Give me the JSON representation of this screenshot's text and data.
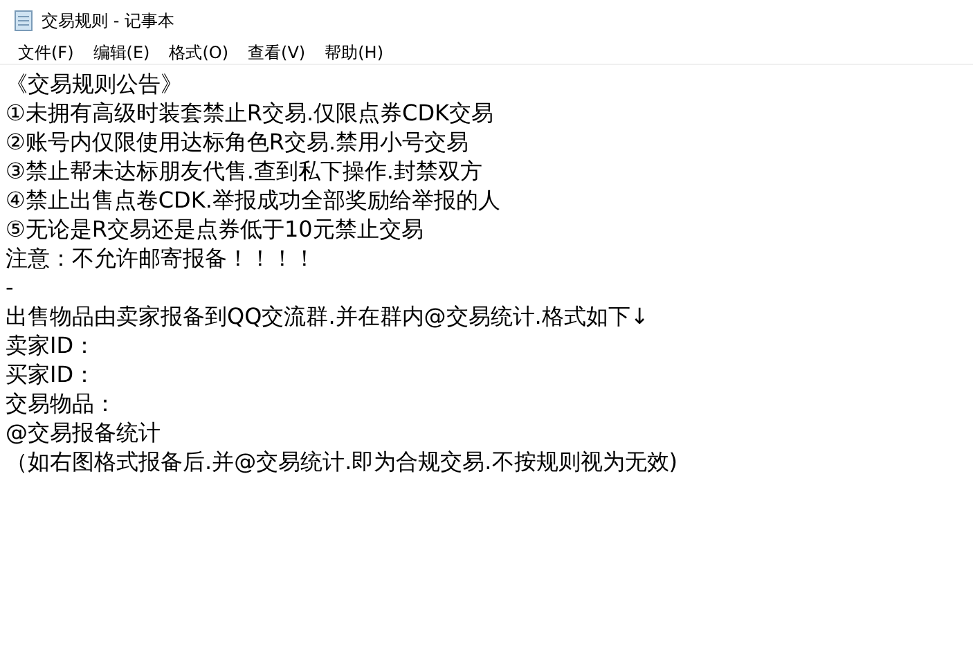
{
  "window": {
    "title": "交易规则 - 记事本"
  },
  "menu": [
    "文件(F)",
    "编辑(E)",
    "格式(O)",
    "查看(V)",
    "帮助(H)"
  ],
  "document": {
    "lines": [
      "《交易规则公告》",
      "①未拥有高级时装套禁止R交易.仅限点券CDK交易",
      "②账号内仅限使用达标角色R交易.禁用小号交易",
      "③禁止帮未达标朋友代售.查到私下操作.封禁双方",
      "④禁止出售点卷CDK.举报成功全部奖励给举报的人",
      "⑤无论是R交易还是点券低于10元禁止交易",
      "注意：不允许邮寄报备！！！！",
      "-",
      "出售物品由卖家报备到QQ交流群.并在群内@交易统计.格式如下↓",
      "卖家ID：",
      "买家ID：",
      "交易物品：",
      "@交易报备统计",
      "（如右图格式报备后.并@交易统计.即为合规交易.不按规则视为无效)"
    ]
  }
}
